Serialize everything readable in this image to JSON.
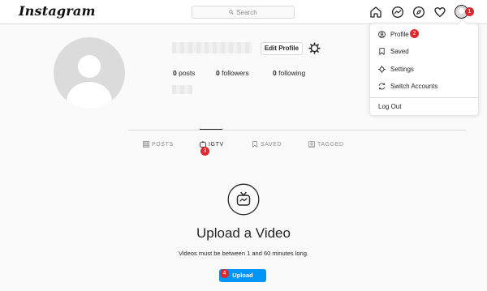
{
  "nav": {
    "logo": "Instagram",
    "search_placeholder": "Search",
    "icons": [
      "home-icon",
      "messenger-icon",
      "explore-icon",
      "heart-icon",
      "avatar"
    ]
  },
  "profile": {
    "edit_label": "Edit Profile",
    "posts_count": "0",
    "posts_label": "posts",
    "followers_count": "0",
    "followers_label": "followers",
    "following_count": "0",
    "following_label": "following"
  },
  "tabs": [
    {
      "label": "POSTS",
      "icon": "grid-icon"
    },
    {
      "label": "IGTV",
      "icon": "igtv-icon"
    },
    {
      "label": "SAVED",
      "icon": "bookmark-icon"
    },
    {
      "label": "TAGGED",
      "icon": "tagged-icon"
    }
  ],
  "empty_state": {
    "title": "Upload a Video",
    "subtitle": "Videos must be between 1 and 60 minutes long.",
    "button_label": "Upload"
  },
  "dropdown": {
    "items": [
      {
        "label": "Profile",
        "icon": "profile-icon"
      },
      {
        "label": "Saved",
        "icon": "bookmark-icon"
      },
      {
        "label": "Settings",
        "icon": "settings-icon"
      },
      {
        "label": "Switch Accounts",
        "icon": "switch-icon"
      }
    ],
    "logout_label": "Log Out"
  },
  "markers": [
    "1",
    "2",
    "3",
    "4"
  ],
  "colors": {
    "accent": "#0095f6",
    "marker": "#e0272c",
    "border": "#dbdbdb",
    "text": "#262626",
    "muted": "#8e8e8e"
  }
}
